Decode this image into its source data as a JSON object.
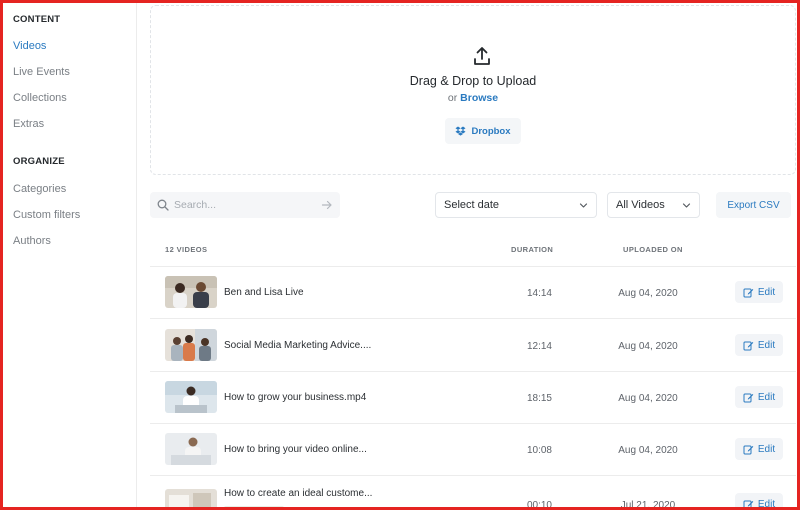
{
  "sidebar": {
    "content_heading": "CONTENT",
    "content_items": [
      {
        "label": "Videos",
        "active": true
      },
      {
        "label": "Live Events",
        "active": false
      },
      {
        "label": "Collections",
        "active": false
      },
      {
        "label": "Extras",
        "active": false
      }
    ],
    "organize_heading": "ORGANIZE",
    "organize_items": [
      {
        "label": "Categories"
      },
      {
        "label": "Custom filters"
      },
      {
        "label": "Authors"
      }
    ]
  },
  "upload": {
    "icon": "upload-icon",
    "title": "Drag & Drop to Upload",
    "or_text": "or",
    "browse_label": "Browse",
    "dropbox_label": "Dropbox",
    "dropbox_icon": "dropbox-icon"
  },
  "toolbar": {
    "search_placeholder": "Search...",
    "date_select_value": "Select date",
    "filter_select_value": "All Videos",
    "export_label": "Export CSV"
  },
  "table": {
    "headers": {
      "count": "12 VIDEOS",
      "duration": "DURATION",
      "uploaded": "UPLOADED ON"
    },
    "rows": [
      {
        "title": "Ben and Lisa Live",
        "duration": "14:14",
        "uploaded": "Aug 04, 2020",
        "edit": "Edit"
      },
      {
        "title": "Social Media Marketing Advice....",
        "duration": "12:14",
        "uploaded": "Aug 04, 2020",
        "edit": "Edit"
      },
      {
        "title": "How to grow your business.mp4",
        "duration": "18:15",
        "uploaded": "Aug 04, 2020",
        "edit": "Edit"
      },
      {
        "title": "How to bring your video online...",
        "duration": "10:08",
        "uploaded": "Aug 04, 2020",
        "edit": "Edit"
      },
      {
        "title": "How to create an ideal custome...",
        "duration": "00:10",
        "uploaded": "Jul 21, 2020",
        "edit": "Edit"
      }
    ]
  },
  "colors": {
    "accent": "#2a7ac0",
    "border_frame": "#e52421"
  }
}
